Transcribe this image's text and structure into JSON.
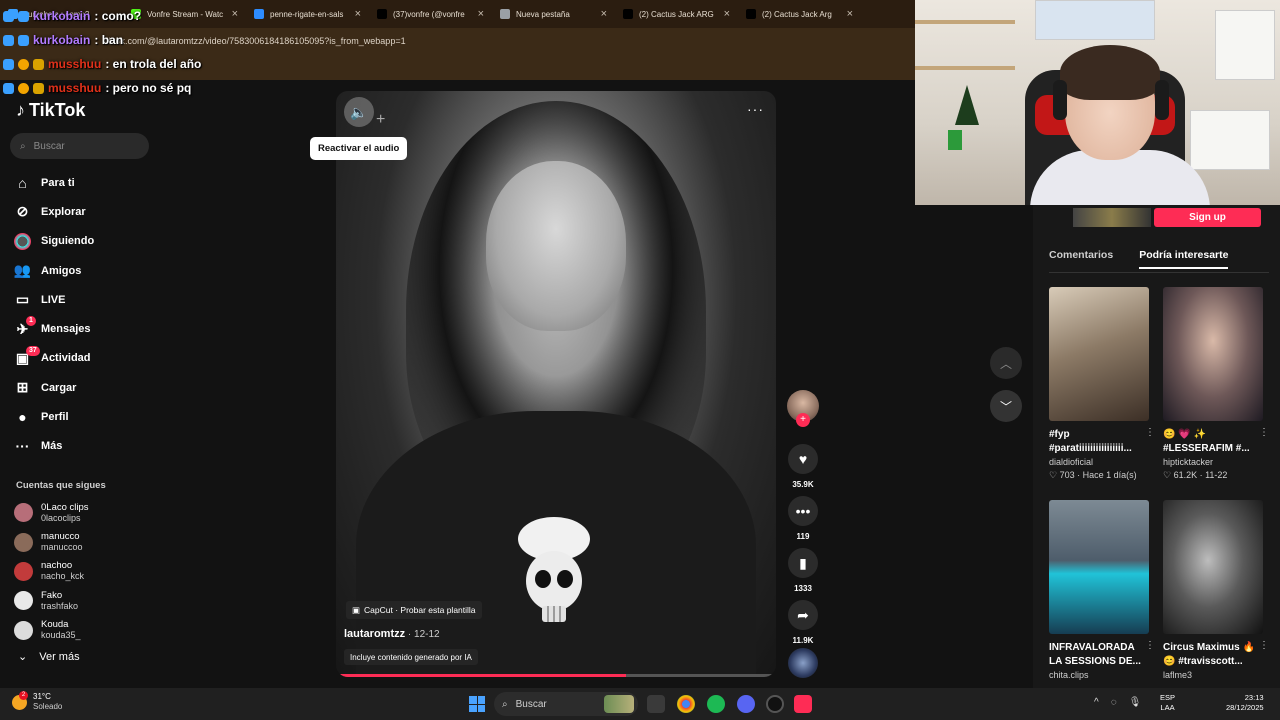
{
  "browser": {
    "tabs": [
      {
        "label": "kurkobain : como?",
        "x_label": "",
        "color": "#3aa0ff"
      },
      {
        "label": "Vonfre Stream - Watc",
        "x_label": "×",
        "color": "#53fc18"
      },
      {
        "label": "penne-rigate-en-sals",
        "x_label": "×",
        "color": "#2d8cff"
      },
      {
        "label": "(37)vonfre (@vonfre",
        "x_label": "×",
        "color": "#000000"
      },
      {
        "label": "Nueva pestaña",
        "x_label": "×",
        "color": "#9aa0a6"
      },
      {
        "label": "(2) Cactus Jack ARG",
        "x_label": "×",
        "color": "#000000"
      },
      {
        "label": "(2) Cactus Jack Arg",
        "x_label": "×",
        "color": "#000000"
      }
    ],
    "url": "tiktok.com/@lautaromtzz/video/7583006184186105095?is_from_webapp=1"
  },
  "chat": {
    "lines": [
      {
        "user": "kurkobain",
        "msg": ": como?",
        "color": "#b37cff"
      },
      {
        "user": "kurkobain",
        "msg": ": ban",
        "color": "#b37cff"
      },
      {
        "user": "musshuu",
        "msg": ": en trola del año",
        "color": "#e0311a"
      },
      {
        "user": "musshuu",
        "msg": ": pero no sé pq",
        "color": "#e0311a"
      }
    ]
  },
  "tiktok": {
    "logo": "TikTok",
    "search_placeholder": "Buscar",
    "nav": [
      {
        "label": "Para ti",
        "icon": "home-icon"
      },
      {
        "label": "Explorar",
        "icon": "compass-icon"
      },
      {
        "label": "Siguiendo",
        "icon": "following-icon"
      },
      {
        "label": "Amigos",
        "icon": "friends-icon"
      },
      {
        "label": "LIVE",
        "icon": "live-icon"
      },
      {
        "label": "Mensajes",
        "icon": "messages-icon",
        "badge": "1"
      },
      {
        "label": "Actividad",
        "icon": "activity-icon",
        "badge": "37"
      },
      {
        "label": "Cargar",
        "icon": "upload-icon"
      },
      {
        "label": "Perfil",
        "icon": "profile-icon"
      },
      {
        "label": "Más",
        "icon": "more-icon"
      }
    ],
    "following_title": "Cuentas que sigues",
    "following": [
      {
        "name": "0Laco clips",
        "user": "0lacoclips"
      },
      {
        "name": "manucco",
        "user": "manuccoo"
      },
      {
        "name": "nachoo",
        "user": "nacho_kck"
      },
      {
        "name": "Fako",
        "user": "trashfako"
      },
      {
        "name": "Kouda",
        "user": "kouda35_"
      }
    ],
    "see_more": "Ver más"
  },
  "video": {
    "tooltip": "Reactivar el audio",
    "capcut": "CapCut · Probar esta plantilla",
    "author": "lautaromtzz",
    "date": " · 12-12",
    "ai_label": "Incluye contenido generado por IA",
    "progress": 0.66
  },
  "actions": {
    "likes": "35.9K",
    "comments": "119",
    "saves": "1333",
    "shares": "11.9K"
  },
  "right_panel": {
    "signup": "Sign up",
    "tabs": [
      "Comentarios",
      "Podría interesarte"
    ],
    "cards": [
      {
        "caption": "#fyp #parati...",
        "caption_full": "#fyp",
        "caption2": "#paratiiiiiiiiiiiiiiii...",
        "user": "dialdioficial",
        "meta": "♡ 703 · Hace 1 día(s)"
      },
      {
        "caption": "😊 💗 ✨",
        "caption2": "#LESSERAFIM #...",
        "user": "hipticktacker",
        "meta": "♡ 61.2K · 11-22"
      },
      {
        "caption": "INFRAVALORADA",
        "caption2": "LA SESSIONS DE...",
        "user": "chita.clips",
        "meta": ""
      },
      {
        "caption": "Circus Maximus 🔥",
        "caption2": "😊 #travisscott...",
        "user": "laflme3",
        "meta": ""
      }
    ]
  },
  "taskbar": {
    "temp": "31°C",
    "weather": "Soleado",
    "weather_badge": "2",
    "search": "Buscar",
    "lang1": "ESP",
    "lang2": "LAA",
    "time": "23:13",
    "date": "28/12/2025"
  }
}
